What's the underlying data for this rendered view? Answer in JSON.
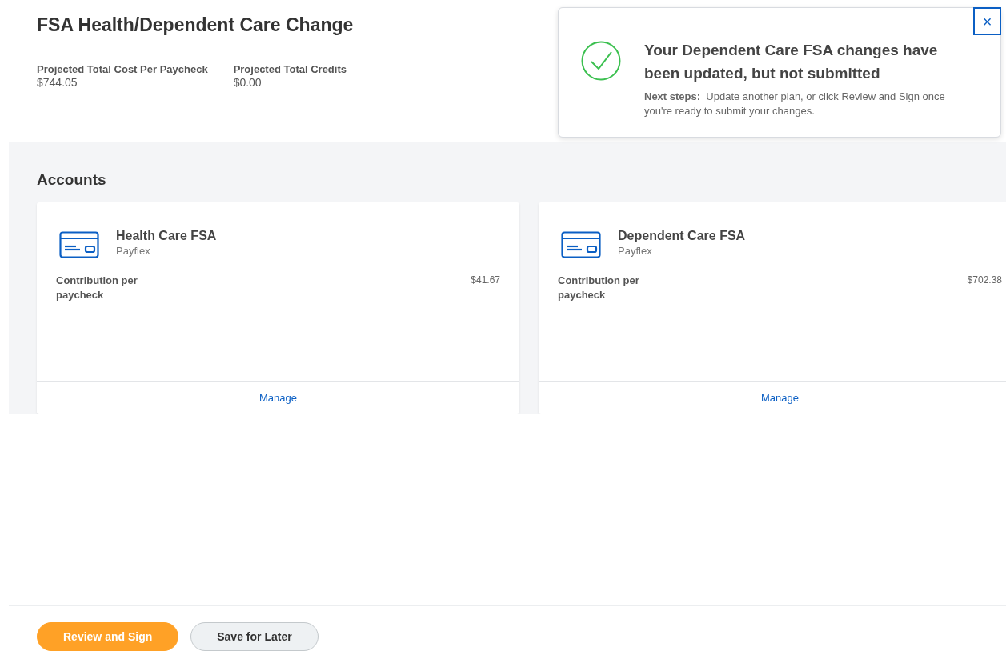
{
  "page": {
    "title": "FSA Health/Dependent Care Change"
  },
  "summary": [
    {
      "label": "Projected Total Cost Per Paycheck",
      "value": "$744.05"
    },
    {
      "label": "Projected Total Credits",
      "value": "$0.00"
    }
  ],
  "accounts": {
    "heading": "Accounts",
    "cards": [
      {
        "name": "Health Care FSA",
        "provider": "Payflex",
        "field_label": "Contribution per paycheck",
        "field_value": "$41.67",
        "action": "Manage"
      },
      {
        "name": "Dependent Care FSA",
        "provider": "Payflex",
        "field_label": "Contribution per paycheck",
        "field_value": "$702.38",
        "action": "Manage"
      }
    ]
  },
  "footer": {
    "buttons": [
      {
        "label": "Review and Sign",
        "kind": "primary"
      },
      {
        "label": "Save for Later",
        "kind": "secondary"
      }
    ]
  },
  "toast": {
    "title": "Your Dependent Care FSA changes have been updated, but not submitted",
    "message": "**Next steps:**  Update another plan, or click Review and Sign once you're ready to submit your changes.",
    "close": "×"
  }
}
